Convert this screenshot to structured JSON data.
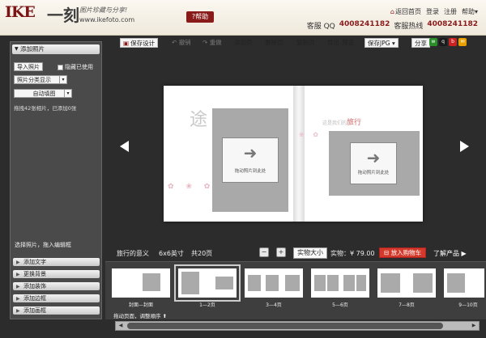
{
  "header": {
    "logo_text": "IKE",
    "logo_cn": "一刻",
    "slogan": "图片珍藏与分享!",
    "site_url": "www.ikefoto.com",
    "help_label": "?帮助",
    "links": {
      "home": "返回首页",
      "login": "登录",
      "register": "注册",
      "help": "帮助"
    },
    "qq_label": "客服 QQ",
    "qq_number": "4008241182",
    "hotline_label": "客服热线",
    "hotline_number": "4008241182"
  },
  "left_panel": {
    "title": "添加照片",
    "import_label": "导入照片",
    "hide_used_label": "隐藏已使用",
    "category_label": "照片分类显示",
    "auto_fill_label": "自动填图",
    "hint": "拖拽42张相片，已添加0张",
    "drag_hint": "选择照片，拖入编辑框",
    "tools": [
      "添加文字",
      "更换背景",
      "添加装饰",
      "添加边框",
      "添加画框"
    ]
  },
  "toolbar": {
    "save_design": "保存设计",
    "undo": "撤销",
    "redo": "重做",
    "add_page": "添加页",
    "delete_page": "删除页",
    "copy_page": "复制页",
    "export": "导出",
    "preview": "预览",
    "save_jpg": "保存JPG",
    "share": "分享"
  },
  "book": {
    "left_title": "途",
    "right_title_prefix": "这是我们的",
    "right_title": "旅行",
    "slot_label": "拖动照片到此处"
  },
  "info_bar": {
    "book_name": "旅行的意义",
    "size": "6x6英寸",
    "pages": "共20页",
    "actual_size": "实物大小",
    "price_label": "实物：¥ 79.00",
    "add_to_cart": "放入购物车",
    "learn_more": "了解产品"
  },
  "thumbnails": [
    {
      "label": "封面—封面"
    },
    {
      "label": "1—2页"
    },
    {
      "label": "3—4页"
    },
    {
      "label": "5—6页"
    },
    {
      "label": "7—8页"
    },
    {
      "label": "9—10页"
    }
  ],
  "sort_hint": "拖动页面，调整顺序",
  "colors": {
    "brand": "#8a1b1b",
    "cart": "#d33a2c",
    "background": "#2c2c2c"
  }
}
